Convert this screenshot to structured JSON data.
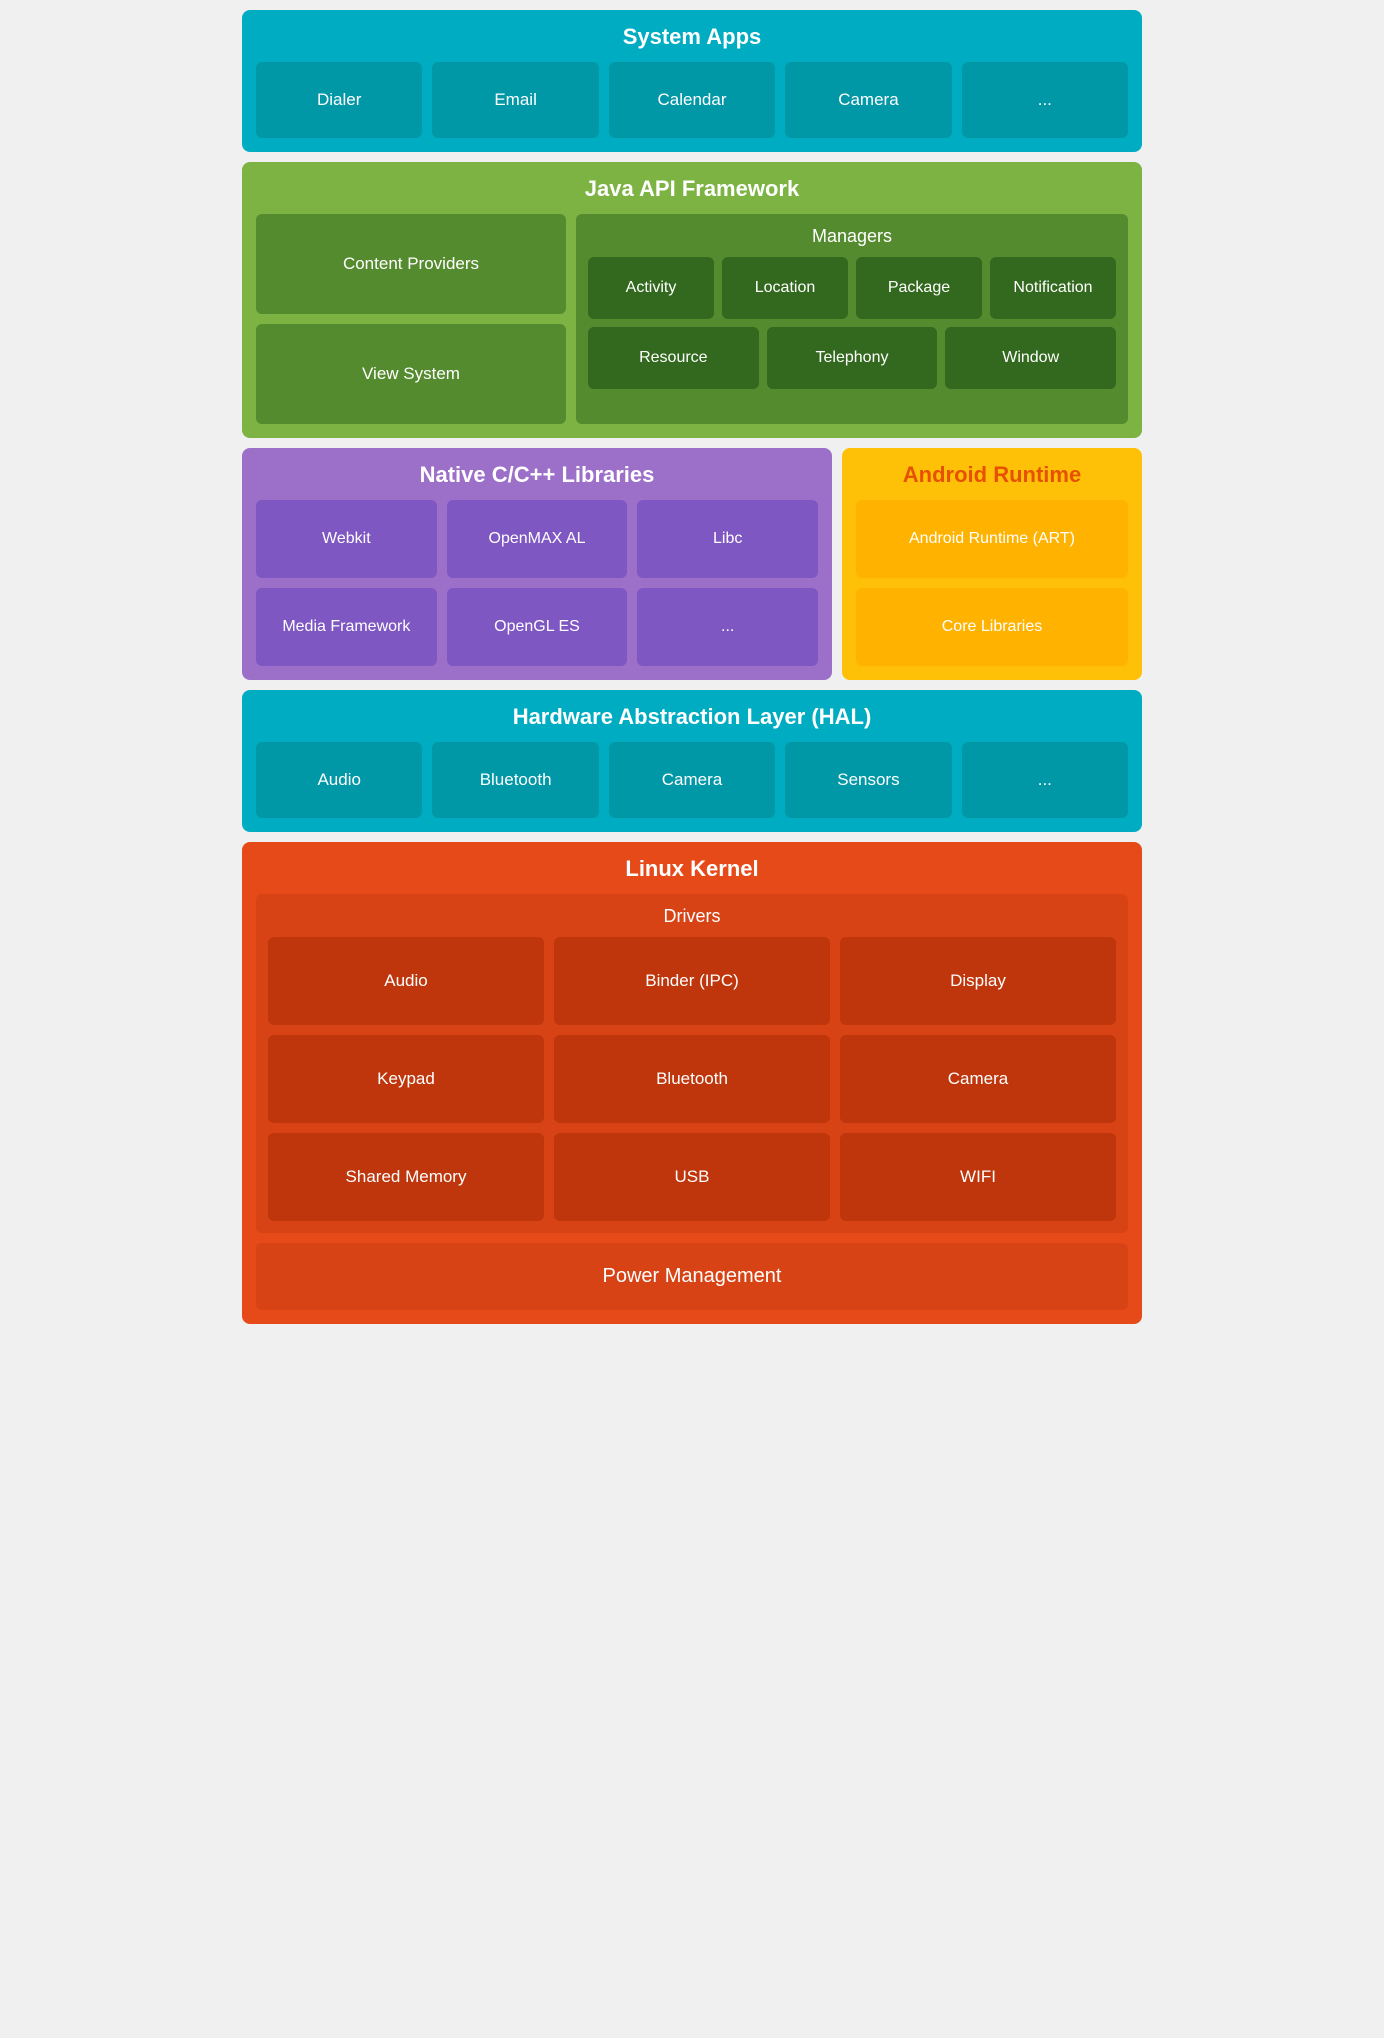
{
  "systemApps": {
    "title": "System Apps",
    "items": [
      "Dialer",
      "Email",
      "Calendar",
      "Camera",
      "..."
    ]
  },
  "javaApi": {
    "title": "Java API Framework",
    "left": [
      "Content Providers",
      "View System"
    ],
    "managers": {
      "title": "Managers",
      "row1": [
        "Activity",
        "Location",
        "Package",
        "Notification"
      ],
      "row2": [
        "Resource",
        "Telephony",
        "Window"
      ]
    }
  },
  "nativeLibs": {
    "title": "Native C/C++ Libraries",
    "row1": [
      "Webkit",
      "OpenMAX AL",
      "Libc"
    ],
    "row2": [
      "Media Framework",
      "OpenGL ES",
      "..."
    ]
  },
  "androidRuntime": {
    "title": "Android Runtime",
    "items": [
      "Android Runtime (ART)",
      "Core Libraries"
    ]
  },
  "hal": {
    "title": "Hardware Abstraction Layer (HAL)",
    "items": [
      "Audio",
      "Bluetooth",
      "Camera",
      "Sensors",
      "..."
    ]
  },
  "linuxKernel": {
    "title": "Linux Kernel",
    "drivers": {
      "title": "Drivers",
      "row1": [
        "Audio",
        "Binder (IPC)",
        "Display"
      ],
      "row2": [
        "Keypad",
        "Bluetooth",
        "Camera"
      ],
      "row3": [
        "Shared Memory",
        "USB",
        "WIFI"
      ]
    },
    "powerManagement": "Power Management"
  }
}
